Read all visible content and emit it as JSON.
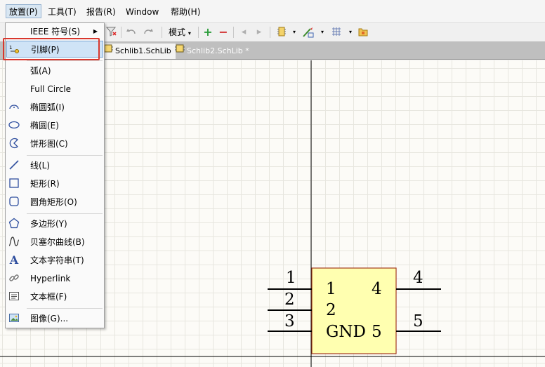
{
  "menubar": {
    "items": [
      {
        "label": "放置(P)",
        "active": true
      },
      {
        "label": "工具(T)"
      },
      {
        "label": "报告(R)"
      },
      {
        "label": "Window"
      },
      {
        "label": "帮助(H)"
      }
    ]
  },
  "toolbar": {
    "mode_label": "模式"
  },
  "tabs": [
    {
      "label": "Schlib1.SchLib",
      "active": true
    },
    {
      "label": "Schlib2.SchLib *",
      "active": false
    }
  ],
  "dropdown": {
    "items": [
      {
        "label": "IEEE 符号(S)",
        "icon": "none",
        "submenu": true
      },
      {
        "label": "引脚(P)",
        "icon": "pin-icon",
        "highlighted": true
      },
      {
        "label": "弧(A)",
        "icon": "none"
      },
      {
        "label": "Full Circle",
        "icon": "none"
      },
      {
        "label": "椭圆弧(I)",
        "icon": "elliptical-arc-icon"
      },
      {
        "label": "椭圆(E)",
        "icon": "ellipse-icon"
      },
      {
        "label": "饼形图(C)",
        "icon": "pie-icon"
      },
      {
        "label": "线(L)",
        "icon": "line-icon"
      },
      {
        "label": "矩形(R)",
        "icon": "rectangle-icon"
      },
      {
        "label": "圆角矩形(O)",
        "icon": "round-rectangle-icon"
      },
      {
        "label": "多边形(Y)",
        "icon": "polygon-icon"
      },
      {
        "label": "贝塞尔曲线(B)",
        "icon": "bezier-icon"
      },
      {
        "label": "文本字符串(T)",
        "icon": "text-string-icon"
      },
      {
        "label": "Hyperlink",
        "icon": "hyperlink-icon"
      },
      {
        "label": "文本框(F)",
        "icon": "text-frame-icon"
      },
      {
        "label": "图像(G)...",
        "icon": "image-icon"
      }
    ]
  },
  "component": {
    "pin_numbers_outside": [
      "1",
      "2",
      "3",
      "4",
      "5"
    ],
    "body_labels": {
      "p1": "1",
      "p2": "2",
      "p4": "4",
      "gnd": "GND",
      "p5": "5"
    },
    "colors": {
      "body_fill": "#ffffb0",
      "body_border": "#a43a1f"
    }
  }
}
